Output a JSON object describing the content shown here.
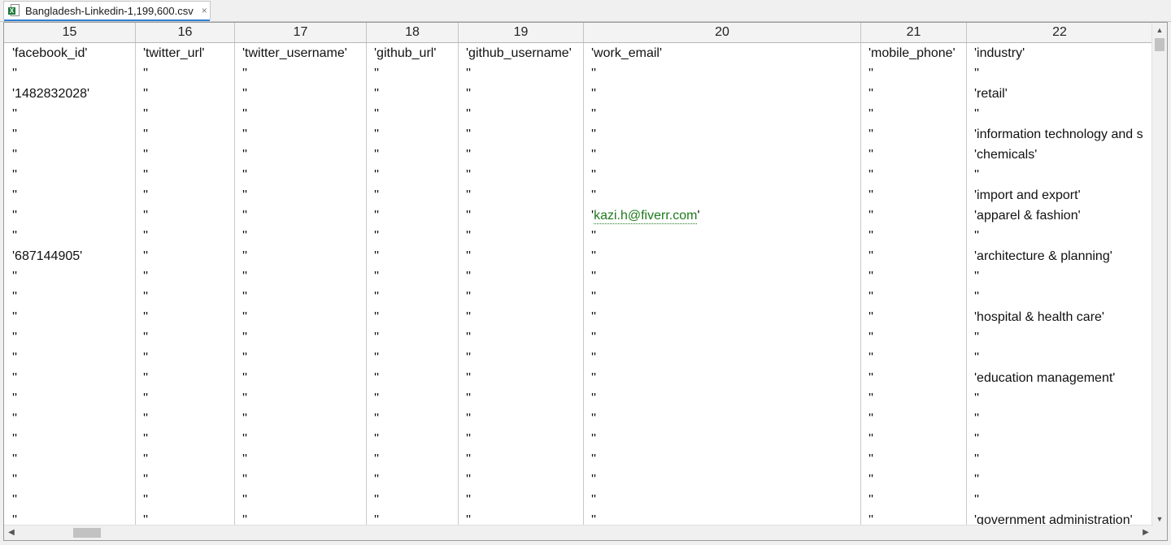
{
  "tab": {
    "icon": "excel-file-icon",
    "badge": "X",
    "title": "Bangladesh-Linkedin-1,199,600.csv",
    "close": "×"
  },
  "columns": [
    "15",
    "16",
    "17",
    "18",
    "19",
    "20",
    "21",
    "22"
  ],
  "rows": [
    [
      "'facebook_id'",
      "'twitter_url'",
      "'twitter_username'",
      "'github_url'",
      "'github_username'",
      "'work_email'",
      "'mobile_phone'",
      "'industry'"
    ],
    [
      "''",
      "''",
      "''",
      "''",
      "''",
      "''",
      "''",
      "''"
    ],
    [
      "'1482832028'",
      "''",
      "''",
      "''",
      "''",
      "''",
      "''",
      "'retail'"
    ],
    [
      "''",
      "''",
      "''",
      "''",
      "''",
      "''",
      "''",
      "''"
    ],
    [
      "''",
      "''",
      "''",
      "''",
      "''",
      "''",
      "''",
      "'information technology and s"
    ],
    [
      "''",
      "''",
      "''",
      "''",
      "''",
      "''",
      "''",
      "'chemicals'"
    ],
    [
      "''",
      "''",
      "''",
      "''",
      "''",
      "''",
      "''",
      "''"
    ],
    [
      "''",
      "''",
      "''",
      "''",
      "''",
      "''",
      "''",
      "'import and export'"
    ],
    [
      "''",
      "''",
      "''",
      "''",
      "''",
      "'kazi.h@fiverr.com'",
      "''",
      "'apparel & fashion'"
    ],
    [
      "''",
      "''",
      "''",
      "''",
      "''",
      "''",
      "''",
      "''"
    ],
    [
      "'687144905'",
      "''",
      "''",
      "''",
      "''",
      "''",
      "''",
      "'architecture & planning'"
    ],
    [
      "''",
      "''",
      "''",
      "''",
      "''",
      "''",
      "''",
      "''"
    ],
    [
      "''",
      "''",
      "''",
      "''",
      "''",
      "''",
      "''",
      "''"
    ],
    [
      "''",
      "''",
      "''",
      "''",
      "''",
      "''",
      "''",
      "'hospital & health care'"
    ],
    [
      "''",
      "''",
      "''",
      "''",
      "''",
      "''",
      "''",
      "''"
    ],
    [
      "''",
      "''",
      "''",
      "''",
      "''",
      "''",
      "''",
      "''"
    ],
    [
      "''",
      "''",
      "''",
      "''",
      "''",
      "''",
      "''",
      "'education management'"
    ],
    [
      "''",
      "''",
      "''",
      "''",
      "''",
      "''",
      "''",
      "''"
    ],
    [
      "''",
      "''",
      "''",
      "''",
      "''",
      "''",
      "''",
      "''"
    ],
    [
      "''",
      "''",
      "''",
      "''",
      "''",
      "''",
      "''",
      "''"
    ],
    [
      "''",
      "''",
      "''",
      "''",
      "''",
      "''",
      "''",
      "''"
    ],
    [
      "''",
      "''",
      "''",
      "''",
      "''",
      "''",
      "''",
      "''"
    ],
    [
      "''",
      "''",
      "''",
      "''",
      "''",
      "''",
      "''",
      "''"
    ],
    [
      "''",
      "''",
      "''",
      "''",
      "''",
      "''",
      "''",
      "'government administration'"
    ]
  ],
  "email_cell": {
    "quote_open": "'",
    "address": "kazi.h@fiverr.com",
    "quote_close": "'"
  },
  "colors": {
    "email_link": "#1d7a1d",
    "tab_accent": "#2f7fd6",
    "excel_green": "#1f7a3a"
  },
  "scrollbars": {
    "up": "▲",
    "down": "▼",
    "left": "◀",
    "right": "▶"
  }
}
